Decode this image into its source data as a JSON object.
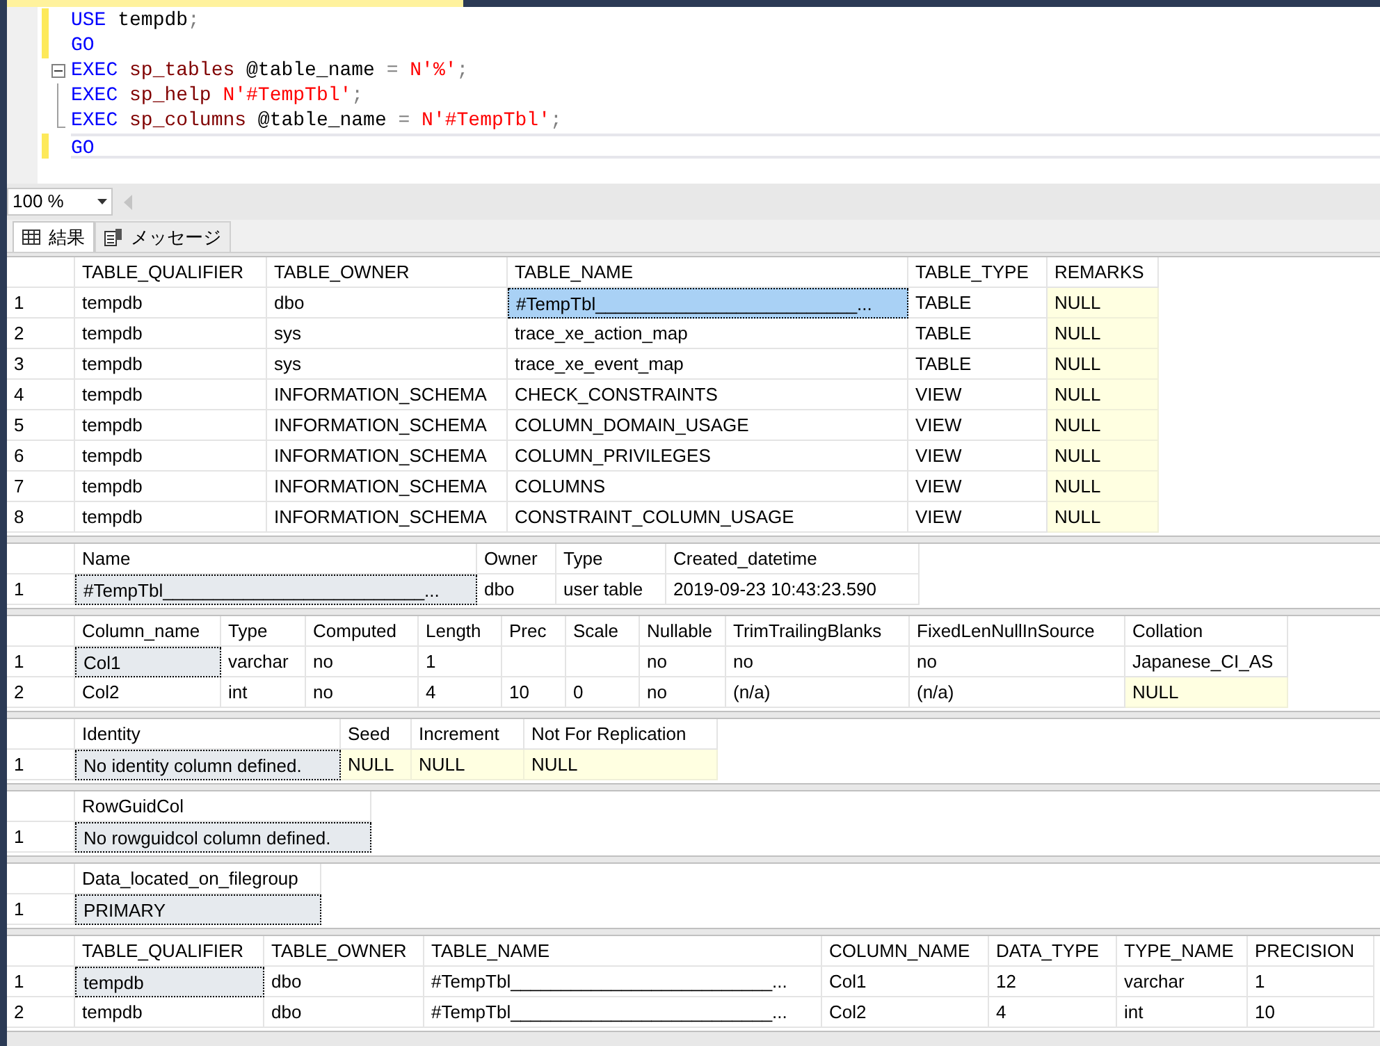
{
  "editor": {
    "lines": [
      {
        "changed": true,
        "current": false,
        "kind": "plain",
        "tokens": [
          {
            "text": "USE",
            "kind": "keyword"
          },
          {
            "text": " tempdb",
            "kind": "plain"
          },
          {
            "text": ";",
            "kind": "operator"
          }
        ]
      },
      {
        "changed": true,
        "current": false,
        "kind": "plain",
        "tokens": [
          {
            "text": "GO",
            "kind": "keyword"
          }
        ]
      },
      {
        "changed": false,
        "current": false,
        "kind": "fold_start",
        "tokens": [
          {
            "text": "EXEC",
            "kind": "keyword"
          },
          {
            "text": " sp_tables",
            "kind": "proc"
          },
          {
            "text": " @table_name ",
            "kind": "plain"
          },
          {
            "text": "=",
            "kind": "operator"
          },
          {
            "text": " N'%'",
            "kind": "string"
          },
          {
            "text": ";",
            "kind": "operator"
          }
        ]
      },
      {
        "changed": false,
        "current": false,
        "kind": "fold_body",
        "tokens": [
          {
            "text": "EXEC",
            "kind": "keyword"
          },
          {
            "text": " sp_help",
            "kind": "proc"
          },
          {
            "text": " N'#TempTbl'",
            "kind": "string"
          },
          {
            "text": ";",
            "kind": "operator"
          }
        ]
      },
      {
        "changed": false,
        "current": false,
        "kind": "fold_end",
        "tokens": [
          {
            "text": "EXEC",
            "kind": "keyword"
          },
          {
            "text": " sp_columns",
            "kind": "proc"
          },
          {
            "text": " @table_name ",
            "kind": "plain"
          },
          {
            "text": "=",
            "kind": "operator"
          },
          {
            "text": " N'#TempTbl'",
            "kind": "string"
          },
          {
            "text": ";",
            "kind": "operator"
          }
        ]
      },
      {
        "changed": true,
        "current": true,
        "kind": "plain",
        "tokens": [
          {
            "text": "GO",
            "kind": "keyword"
          }
        ]
      }
    ]
  },
  "zoom": {
    "value": "100 %"
  },
  "tabs": [
    {
      "label": "結果",
      "selected": true,
      "kind": "grid"
    },
    {
      "label": "メッセージ",
      "selected": false,
      "kind": "messages"
    }
  ],
  "grids": [
    {
      "active": true,
      "columns": [
        "TABLE_QUALIFIER",
        "TABLE_OWNER",
        "TABLE_NAME",
        "TABLE_TYPE",
        "REMARKS"
      ],
      "rows": [
        {
          "number": "1",
          "cells": [
            "tempdb",
            "dbo",
            {
              "text": "#TempTbl__________________________...",
              "current": true
            },
            "TABLE",
            {
              "text": "NULL",
              "null": true
            }
          ]
        },
        {
          "number": "2",
          "cells": [
            "tempdb",
            "sys",
            "trace_xe_action_map",
            "TABLE",
            {
              "text": "NULL",
              "null": true
            }
          ]
        },
        {
          "number": "3",
          "cells": [
            "tempdb",
            "sys",
            "trace_xe_event_map",
            "TABLE",
            {
              "text": "NULL",
              "null": true
            }
          ]
        },
        {
          "number": "4",
          "cells": [
            "tempdb",
            "INFORMATION_SCHEMA",
            "CHECK_CONSTRAINTS",
            "VIEW",
            {
              "text": "NULL",
              "null": true
            }
          ]
        },
        {
          "number": "5",
          "cells": [
            "tempdb",
            "INFORMATION_SCHEMA",
            "COLUMN_DOMAIN_USAGE",
            "VIEW",
            {
              "text": "NULL",
              "null": true
            }
          ]
        },
        {
          "number": "6",
          "cells": [
            "tempdb",
            "INFORMATION_SCHEMA",
            "COLUMN_PRIVILEGES",
            "VIEW",
            {
              "text": "NULL",
              "null": true
            }
          ]
        },
        {
          "number": "7",
          "cells": [
            "tempdb",
            "INFORMATION_SCHEMA",
            "COLUMNS",
            "VIEW",
            {
              "text": "NULL",
              "null": true
            }
          ]
        },
        {
          "number": "8",
          "cells": [
            "tempdb",
            "INFORMATION_SCHEMA",
            "CONSTRAINT_COLUMN_USAGE",
            "VIEW",
            {
              "text": "NULL",
              "null": true
            }
          ]
        }
      ]
    },
    {
      "active": false,
      "columns": [
        "Name",
        "Owner",
        "Type",
        "Created_datetime"
      ],
      "rows": [
        {
          "number": "1",
          "cells": [
            {
              "text": "#TempTbl__________________________...",
              "current": true
            },
            "dbo",
            "user table",
            "2019-09-23 10:43:23.590"
          ]
        }
      ]
    },
    {
      "active": false,
      "columns": [
        "Column_name",
        "Type",
        "Computed",
        "Length",
        "Prec",
        "Scale",
        "Nullable",
        "TrimTrailingBlanks",
        "FixedLenNullInSource",
        "Collation"
      ],
      "rows": [
        {
          "number": "1",
          "cells": [
            {
              "text": "Col1",
              "current": true
            },
            "varchar",
            "no",
            "1",
            "",
            "",
            "no",
            "no",
            "no",
            "Japanese_CI_AS"
          ]
        },
        {
          "number": "2",
          "cells": [
            "Col2",
            "int",
            "no",
            "4",
            "10",
            "0",
            "no",
            "(n/a)",
            "(n/a)",
            {
              "text": "NULL",
              "null": true
            }
          ]
        }
      ]
    },
    {
      "active": false,
      "columns": [
        "Identity",
        "Seed",
        "Increment",
        "Not For Replication"
      ],
      "rows": [
        {
          "number": "1",
          "cells": [
            {
              "text": "No identity column defined.",
              "current": true
            },
            {
              "text": "NULL",
              "null": true
            },
            {
              "text": "NULL",
              "null": true
            },
            {
              "text": "NULL",
              "null": true
            }
          ]
        }
      ]
    },
    {
      "active": false,
      "columns": [
        "RowGuidCol"
      ],
      "rows": [
        {
          "number": "1",
          "cells": [
            {
              "text": "No rowguidcol column defined.",
              "current": true
            }
          ]
        }
      ]
    },
    {
      "active": false,
      "columns": [
        "Data_located_on_filegroup"
      ],
      "rows": [
        {
          "number": "1",
          "cells": [
            {
              "text": "PRIMARY",
              "current": true
            }
          ]
        }
      ]
    },
    {
      "active": false,
      "columns": [
        "TABLE_QUALIFIER",
        "TABLE_OWNER",
        "TABLE_NAME",
        "COLUMN_NAME",
        "DATA_TYPE",
        "TYPE_NAME",
        "PRECISION"
      ],
      "rows": [
        {
          "number": "1",
          "cells": [
            {
              "text": "tempdb",
              "current": true
            },
            "dbo",
            "#TempTbl__________________________...",
            "Col1",
            "12",
            "varchar",
            "1"
          ]
        },
        {
          "number": "2",
          "cells": [
            "tempdb",
            "dbo",
            "#TempTbl__________________________...",
            "Col2",
            "4",
            "int",
            "10"
          ]
        }
      ]
    }
  ]
}
